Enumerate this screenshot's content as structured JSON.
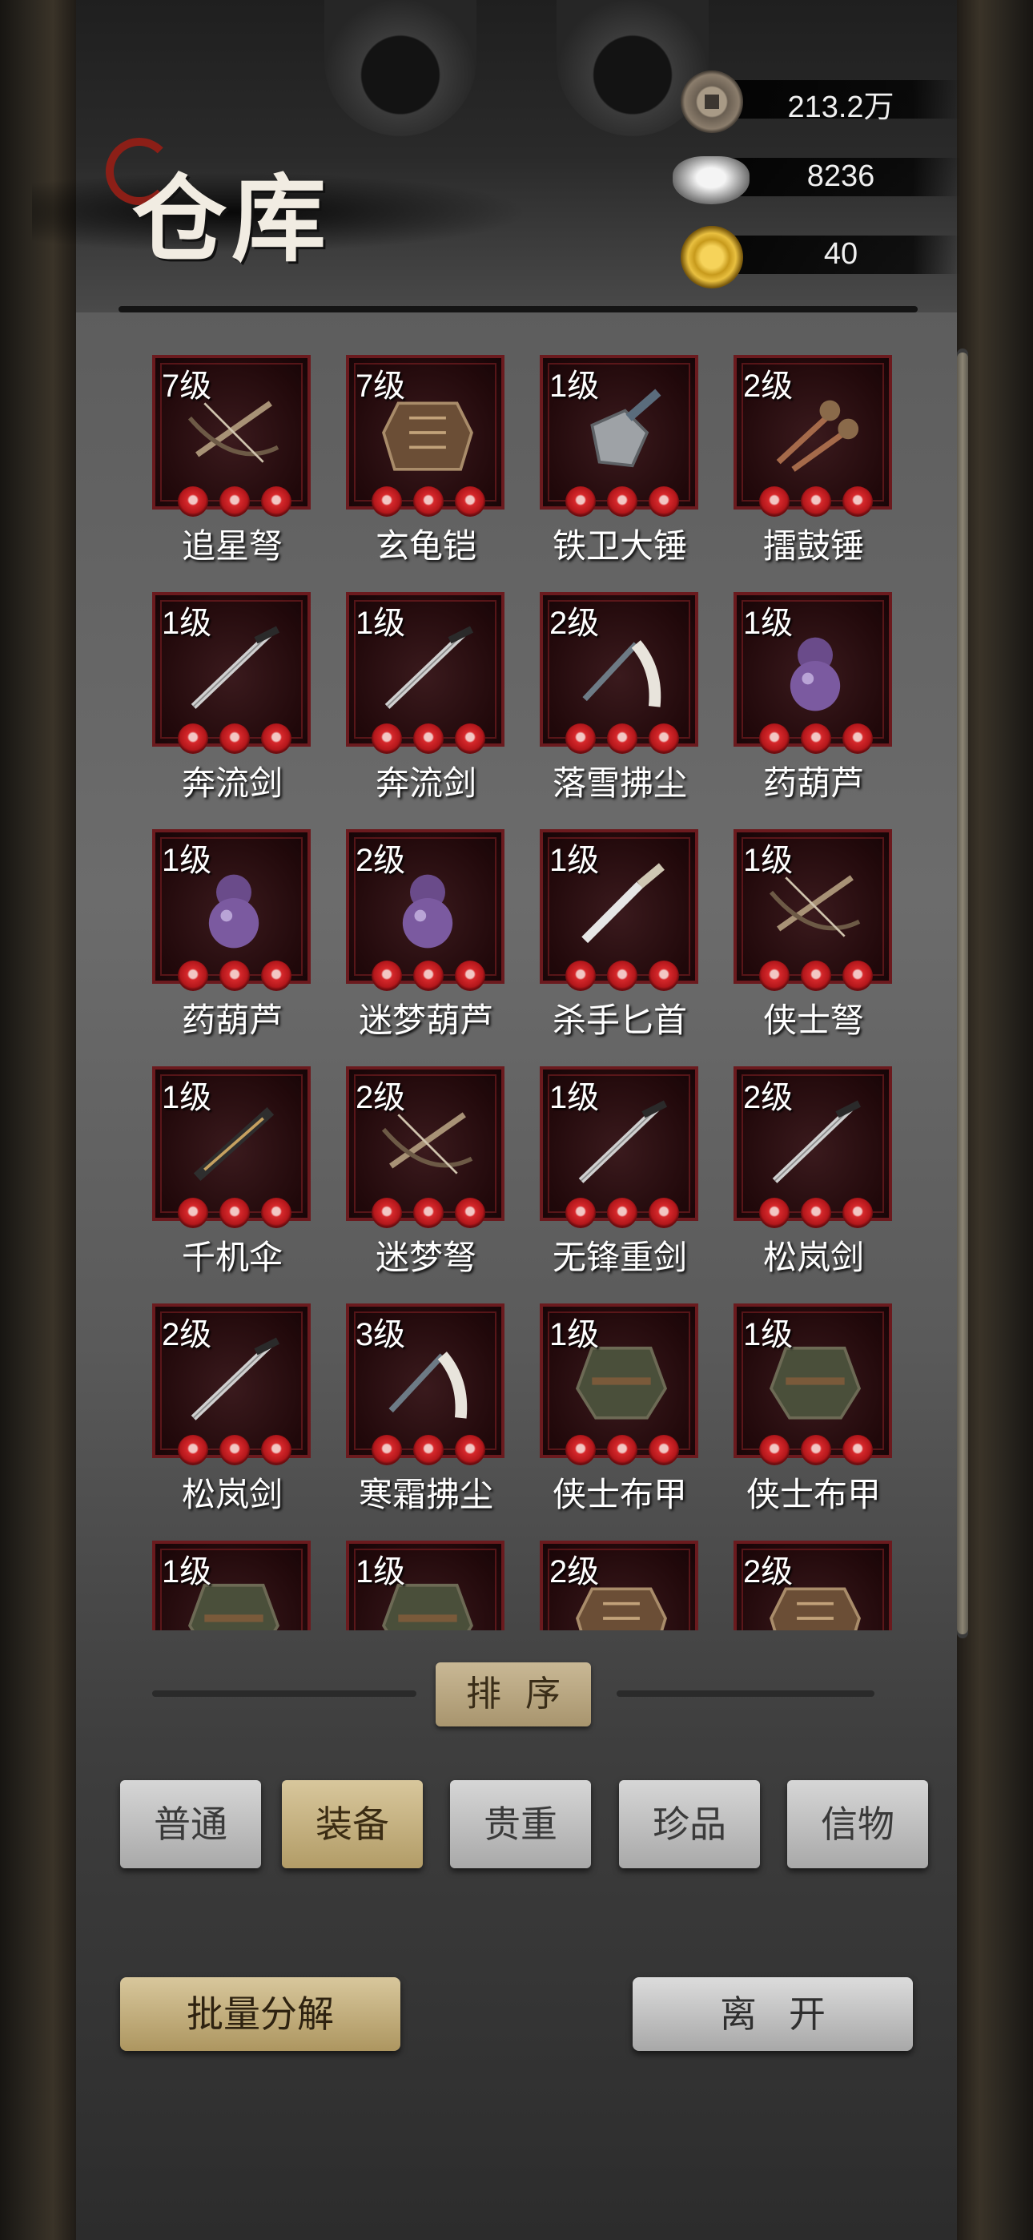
{
  "title": "仓库",
  "currency": {
    "copper": "213.2万",
    "silver": "8236",
    "gold": "40",
    "copper_icon": "copper-coin-icon",
    "silver_icon": "silver-ingot-icon",
    "gold_icon": "gold-coin-icon"
  },
  "items": [
    {
      "level": "7级",
      "name": "追星弩",
      "icon": "crossbow-icon"
    },
    {
      "level": "7级",
      "name": "玄龟铠",
      "icon": "armor-icon"
    },
    {
      "level": "1级",
      "name": "铁卫大锤",
      "icon": "hammer-icon"
    },
    {
      "level": "2级",
      "name": "擂鼓锤",
      "icon": "mace-icon"
    },
    {
      "level": "1级",
      "name": "奔流剑",
      "icon": "sword-icon"
    },
    {
      "level": "1级",
      "name": "奔流剑",
      "icon": "sword-icon"
    },
    {
      "level": "2级",
      "name": "落雪拂尘",
      "icon": "whisk-icon"
    },
    {
      "level": "1级",
      "name": "药葫芦",
      "icon": "gourd-icon"
    },
    {
      "level": "1级",
      "name": "药葫芦",
      "icon": "gourd-icon"
    },
    {
      "level": "2级",
      "name": "迷梦葫芦",
      "icon": "gourd-icon"
    },
    {
      "level": "1级",
      "name": "杀手匕首",
      "icon": "dagger-icon"
    },
    {
      "level": "1级",
      "name": "侠士弩",
      "icon": "crossbow-icon"
    },
    {
      "level": "1级",
      "name": "千机伞",
      "icon": "umbrella-icon"
    },
    {
      "level": "2级",
      "name": "迷梦弩",
      "icon": "crossbow-icon"
    },
    {
      "level": "1级",
      "name": "无锋重剑",
      "icon": "sword-icon"
    },
    {
      "level": "2级",
      "name": "松岚剑",
      "icon": "sword-icon"
    },
    {
      "level": "2级",
      "name": "松岚剑",
      "icon": "sword-icon"
    },
    {
      "level": "3级",
      "name": "寒霜拂尘",
      "icon": "whisk-icon"
    },
    {
      "level": "1级",
      "name": "侠士布甲",
      "icon": "robe-icon"
    },
    {
      "level": "1级",
      "name": "侠士布甲",
      "icon": "robe-icon"
    },
    {
      "level": "1级",
      "name": "",
      "icon": "robe-icon"
    },
    {
      "level": "1级",
      "name": "",
      "icon": "robe-icon"
    },
    {
      "level": "2级",
      "name": "",
      "icon": "armor-icon"
    },
    {
      "level": "2级",
      "name": "",
      "icon": "armor-icon"
    }
  ],
  "sort_label": "排序",
  "tabs": [
    {
      "label": "普通",
      "active": false
    },
    {
      "label": "装备",
      "active": true
    },
    {
      "label": "贵重",
      "active": false
    },
    {
      "label": "珍品",
      "active": false
    },
    {
      "label": "信物",
      "active": false
    }
  ],
  "buttons": {
    "bulk": "批量分解",
    "leave": "离开"
  },
  "colors": {
    "tile_border": "#6b1a1e",
    "slot_red": "#d6282b",
    "active_tab": "#c9b88a"
  }
}
